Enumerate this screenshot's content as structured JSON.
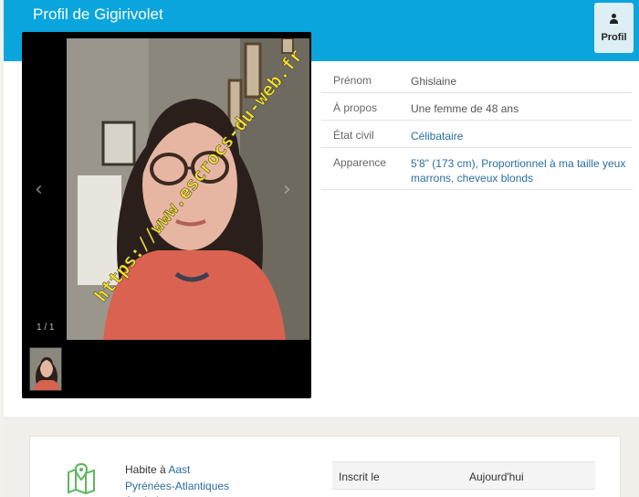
{
  "header": {
    "title": "Profil de Gigirivolet",
    "profile_button_label": "Profil"
  },
  "gallery": {
    "counter": "1 / 1",
    "watermark": "https://www.escrocs-du-web.fr"
  },
  "details": [
    {
      "label": "Prénom",
      "value": "Ghislaine",
      "link": false
    },
    {
      "label": "À propos",
      "value": "Une femme de 48 ans",
      "link": false
    },
    {
      "label": "État civil",
      "value": "Célibataire",
      "link": true
    },
    {
      "label": "Apparence",
      "value": "5'8\" (173 cm), Proportionnel à ma taille yeux marrons, cheveux blonds",
      "link": true
    }
  ],
  "location": {
    "prefix": "Habite à",
    "city": "Aast",
    "region": "Pyrénées-Atlantiques",
    "country": "Aquitaine"
  },
  "registration": {
    "label": "Inscrit le",
    "value": "Aujourd'hui"
  },
  "colors": {
    "header_bg": "#0aa5dd",
    "link": "#2b6ea0",
    "map_icon": "#5cb85c"
  }
}
